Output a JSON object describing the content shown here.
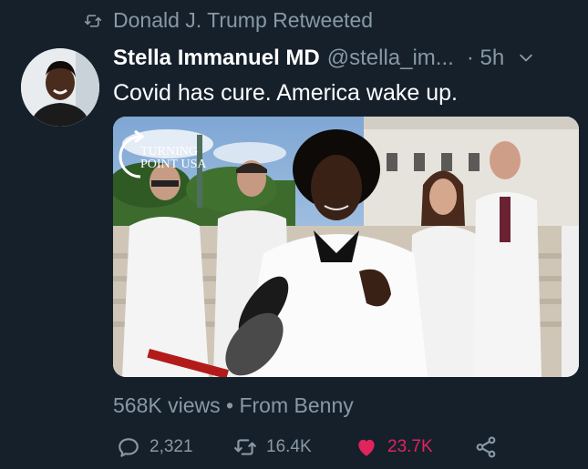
{
  "retweet": {
    "icon": "retweet-icon",
    "text": "Donald J. Trump Retweeted"
  },
  "tweet": {
    "author": {
      "display_name": "Stella Immanuel MD",
      "handle": "@stella_im...",
      "avatar": "avatar-photo"
    },
    "time": "· 5h",
    "text": "Covid has cure. America wake up.",
    "media": {
      "watermark_line1": "TURNING",
      "watermark_line2": "POINT USA"
    },
    "views": "568K views",
    "source": "From Benny",
    "separator": "•",
    "actions": {
      "reply_count": "2,321",
      "retweet_count": "16.4K",
      "like_count": "23.7K"
    }
  },
  "colors": {
    "background": "#15202b",
    "secondary_text": "#8899a6",
    "like": "#e0245e"
  }
}
